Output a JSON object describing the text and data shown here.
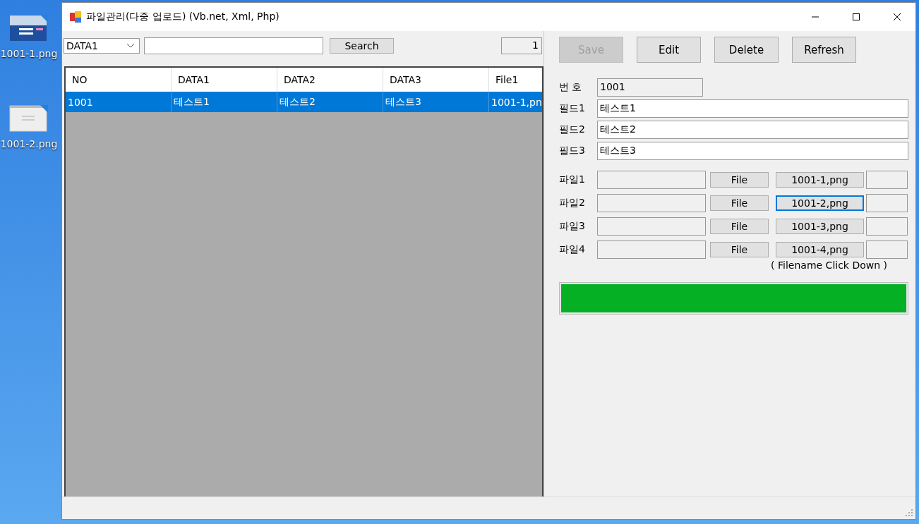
{
  "desktop_icons": [
    {
      "label": "1001-1.png"
    },
    {
      "label": "1001-2.png"
    }
  ],
  "window": {
    "title": "파일관리(다중 업로드) (Vb.net, Xml, Php)"
  },
  "search_bar": {
    "field_select": "DATA1",
    "search_button": "Search",
    "count": "1"
  },
  "table": {
    "columns": [
      "NO",
      "DATA1",
      "DATA2",
      "DATA3",
      "File1"
    ],
    "rows": [
      {
        "cells": [
          "1001",
          "테스트1",
          "테스트2",
          "테스트3",
          "1001-1,pn"
        ],
        "selected": true
      }
    ]
  },
  "buttons": [
    {
      "label": "Save",
      "disabled": true
    },
    {
      "label": "Edit",
      "disabled": false
    },
    {
      "label": "Delete",
      "disabled": false
    },
    {
      "label": "Refresh",
      "disabled": false
    }
  ],
  "form": {
    "number_label": "번 호",
    "number": "1001",
    "fields": [
      {
        "label": "필드1",
        "value": "테스트1"
      },
      {
        "label": "필드2",
        "value": "테스트2"
      },
      {
        "label": "필드3",
        "value": "테스트3"
      }
    ]
  },
  "files": [
    {
      "label": "파일1",
      "browse_button": "File",
      "filename": "1001-1,png",
      "focused": false
    },
    {
      "label": "파일2",
      "browse_button": "File",
      "filename": "1001-2,png",
      "focused": true
    },
    {
      "label": "파일3",
      "browse_button": "File",
      "filename": "1001-3,png",
      "focused": false
    },
    {
      "label": "파일4",
      "browse_button": "File",
      "filename": "1001-4,png",
      "focused": false
    }
  ],
  "hint": "( Filename Click Down )",
  "progress": {
    "level": 1
  }
}
